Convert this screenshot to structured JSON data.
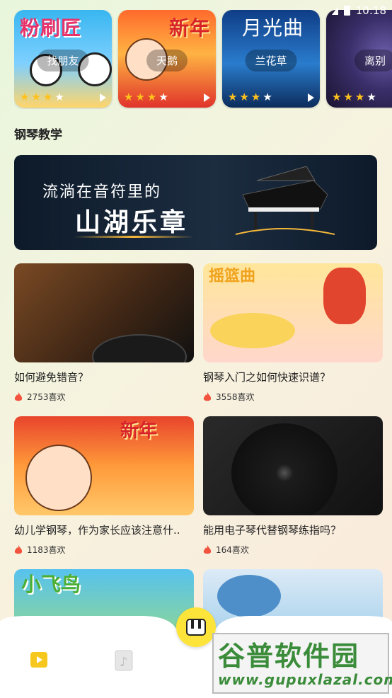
{
  "status_bar": {
    "time": "10:18"
  },
  "songs": [
    {
      "title_art": "粉刷匠",
      "name": "找朋友",
      "rating": 3
    },
    {
      "title_art": "新年",
      "name": "天鹅",
      "rating": 3
    },
    {
      "title_art": "月光曲",
      "name": "兰花草",
      "rating": 3
    },
    {
      "title_art": "",
      "name": "离别",
      "rating": 3
    }
  ],
  "section": {
    "title": "钢琴教学"
  },
  "banner": {
    "line1": "流淌在音符里的",
    "line2": "山湖乐章"
  },
  "lessons": [
    {
      "title": "如何避免错音？",
      "likes": "2753喜欢"
    },
    {
      "title": "钢琴入门之如何快速识谱？",
      "thumb_text": "摇篮曲",
      "likes": "3558喜欢"
    },
    {
      "title": "幼儿学钢琴，作为家长应该注意什..",
      "thumb_text": "新年",
      "likes": "1183喜欢"
    },
    {
      "title": "能用电子琴代替钢琴练指吗？",
      "likes": "164喜欢"
    },
    {
      "title": "",
      "thumb_text": "小飞鸟",
      "likes": ""
    },
    {
      "title": "",
      "likes": ""
    }
  ],
  "watermark": {
    "title": "谷普软件园",
    "url": "www.gupuxlazal.com"
  },
  "colors": {
    "accent": "#fde43a",
    "star": "#ffc21c",
    "fire": "#f1533e"
  }
}
